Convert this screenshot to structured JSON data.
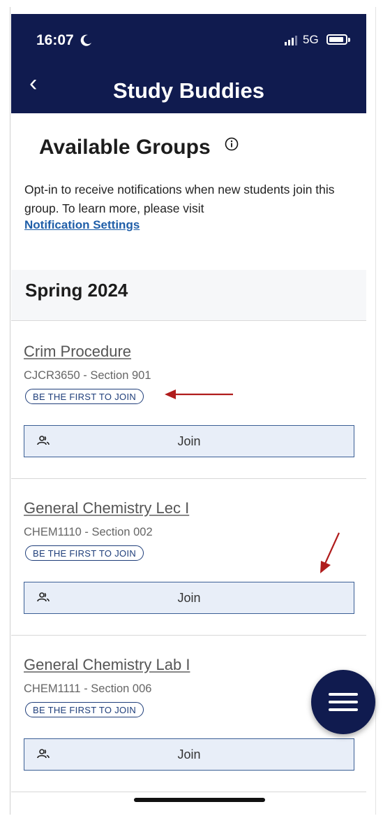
{
  "status_bar": {
    "time": "16:07",
    "network": "5G"
  },
  "header": {
    "title": "Study Buddies"
  },
  "section": {
    "heading": "Available Groups",
    "description": "Opt-in to receive notifications when new students join this group. To learn more, please visit",
    "link": "Notification Settings"
  },
  "term": "Spring 2024",
  "groups": [
    {
      "name": "Crim Procedure",
      "code": "CJCR3650 - Section 901",
      "badge": "BE THE FIRST TO JOIN",
      "button": "Join"
    },
    {
      "name": "General Chemistry Lec I",
      "code": "CHEM1110 - Section 002",
      "badge": "BE THE FIRST TO JOIN",
      "button": "Join"
    },
    {
      "name": "General Chemistry Lab I",
      "code": "CHEM1111 - Section 006",
      "badge": "BE THE FIRST TO JOIN",
      "button": "Join"
    }
  ],
  "colors": {
    "brand": "#101b4f",
    "link": "#1f5ea8",
    "button_bg": "#e8eef8",
    "annotation": "#b01c1c"
  },
  "icons": [
    "moon-icon",
    "signal-icon",
    "battery-icon",
    "back-chevron-icon",
    "info-icon",
    "people-icon",
    "menu-icon"
  ]
}
